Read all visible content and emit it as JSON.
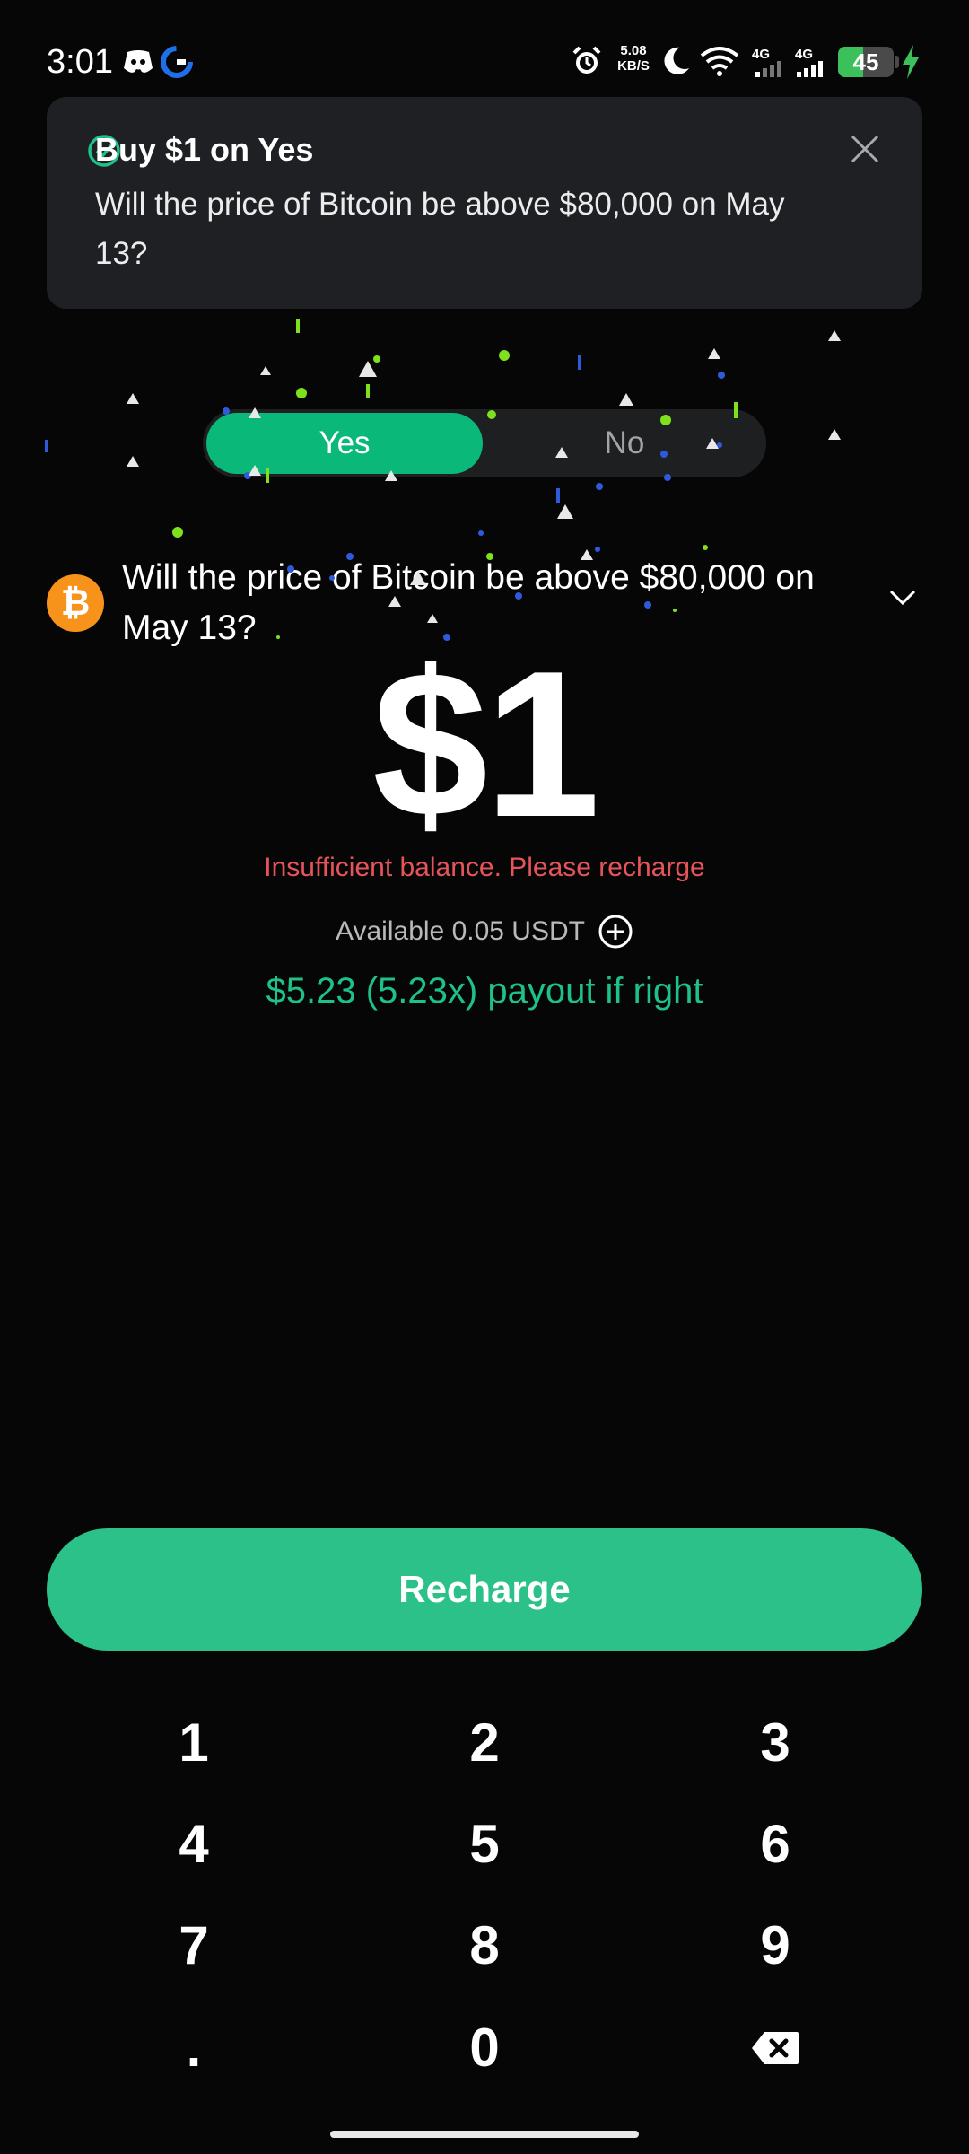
{
  "status_bar": {
    "time": "3:01",
    "net_speed_value": "5.08",
    "net_speed_unit": "KB/S",
    "signal_1": "4G",
    "signal_2": "4G",
    "battery": "45",
    "battery_level": 0.45,
    "icons": [
      "discord-icon",
      "app-g-icon",
      "alarm-icon",
      "moon-icon",
      "wifi-icon",
      "signal-icon",
      "battery-icon",
      "charging-icon"
    ]
  },
  "toast": {
    "title": "Buy $1 on Yes",
    "body": "Will the price of Bitcoin be above $80,000 on May 13?",
    "icons": [
      "check-circle-icon",
      "close-icon"
    ]
  },
  "market": {
    "question": "Will the price of Bitcoin be above $80,000 on May 13?",
    "coin_symbol": "₿",
    "icons": [
      "bitcoin-icon",
      "chevron-down-icon"
    ]
  },
  "toggle": {
    "yes_label": "Yes",
    "no_label": "No",
    "selected": "Yes"
  },
  "trade": {
    "amount": "$1",
    "error": "Insufficient balance. Please recharge",
    "available": "Available 0.05 USDT",
    "payout": "$5.23 (5.23x) payout if right",
    "icons": [
      "plus-circle-icon"
    ]
  },
  "recharge_label": "Recharge",
  "keypad": {
    "keys": [
      "1",
      "2",
      "3",
      "4",
      "5",
      "6",
      "7",
      "8",
      "9",
      ".",
      "0"
    ],
    "icons": [
      "backspace-icon"
    ]
  },
  "colors": {
    "accent_green": "#0ab97a",
    "recharge_green": "#2bc189",
    "payout_green": "#1ec187",
    "error_red": "#e5545a",
    "bitcoin_orange": "#f7931a",
    "background": "#060606"
  }
}
